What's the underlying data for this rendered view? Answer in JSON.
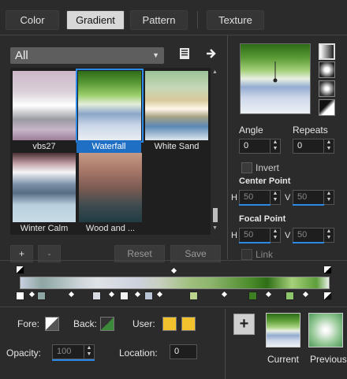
{
  "tabs": [
    {
      "label": "Color"
    },
    {
      "label": "Gradient",
      "active": true
    },
    {
      "label": "Pattern"
    },
    {
      "label": "Texture"
    }
  ],
  "gallery": {
    "category": "All",
    "items": [
      {
        "label": "vbs27"
      },
      {
        "label": "Waterfall",
        "selected": true
      },
      {
        "label": "White Sand"
      },
      {
        "label": "Winter Calm"
      },
      {
        "label": "Wood and ..."
      }
    ]
  },
  "buttons": {
    "add": "+",
    "remove": "-",
    "reset": "Reset",
    "save": "Save"
  },
  "settings": {
    "angle_label": "Angle",
    "angle_value": "0",
    "repeats_label": "Repeats",
    "repeats_value": "0",
    "invert_label": "Invert",
    "center_point_label": "Center Point",
    "center_h_label": "H",
    "center_h_value": "50",
    "center_v_label": "V",
    "center_v_value": "50",
    "focal_point_label": "Focal Point",
    "focal_h_label": "H",
    "focal_h_value": "50",
    "focal_v_label": "V",
    "focal_v_value": "50",
    "link_label": "Link"
  },
  "editor": {
    "fore_label": "Fore:",
    "back_label": "Back:",
    "user_label": "User:",
    "opacity_label": "Opacity:",
    "opacity_value": "100",
    "location_label": "Location:",
    "location_value": "0",
    "user_color": "#f2c12e"
  },
  "swatches": {
    "add": "+",
    "current_label": "Current",
    "previous_label": "Previous"
  },
  "icons": {
    "save_preset": "save-icon",
    "next": "arrow-right-icon"
  }
}
